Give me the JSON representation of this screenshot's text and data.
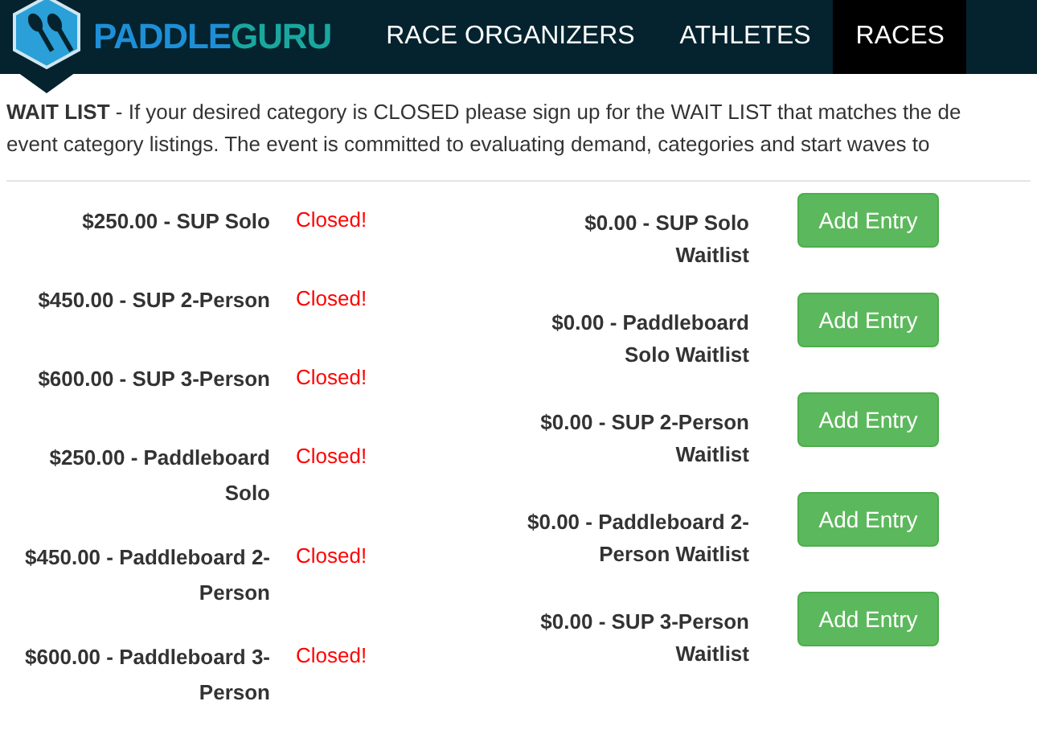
{
  "header": {
    "logo": {
      "first": "PADDLE",
      "second": "GURU"
    },
    "nav": [
      {
        "label": "RACE ORGANIZERS",
        "selected": false
      },
      {
        "label": "ATHLETES",
        "selected": false
      },
      {
        "label": "RACES",
        "selected": true
      }
    ]
  },
  "notice": {
    "lines": [
      "**WAIT LIST** - If your desired category is CLOSED please sign up for the WAIT LIST that matches the de",
      "event category  listings.  The event is committed to evaluating demand, categories and start waves to"
    ]
  },
  "categories": [
    {
      "label": "$250.00 - SUP Solo",
      "status": "Closed!"
    },
    {
      "label": "$450.00 - SUP 2-Person",
      "status": "Closed!"
    },
    {
      "label": "$600.00 - SUP 3-Person",
      "status": "Closed!"
    },
    {
      "label": "$250.00 - Paddleboard Solo",
      "status": "Closed!"
    },
    {
      "label": "$450.00 - Paddleboard 2-Person",
      "status": "Closed!"
    },
    {
      "label": "$600.00 - Paddleboard 3-Person",
      "status": "Closed!"
    }
  ],
  "waitlists": [
    {
      "label": "$0.00 - SUP Solo Waitlist",
      "button": "Add Entry"
    },
    {
      "label": "$0.00 - Paddleboard Solo Waitlist",
      "button": "Add Entry"
    },
    {
      "label": "$0.00 - SUP 2-Person Waitlist",
      "button": "Add Entry"
    },
    {
      "label": "$0.00 - Paddleboard 2-Person Waitlist",
      "button": "Add Entry"
    },
    {
      "label": "$0.00 - SUP 3-Person Waitlist",
      "button": "Add Entry"
    }
  ]
}
